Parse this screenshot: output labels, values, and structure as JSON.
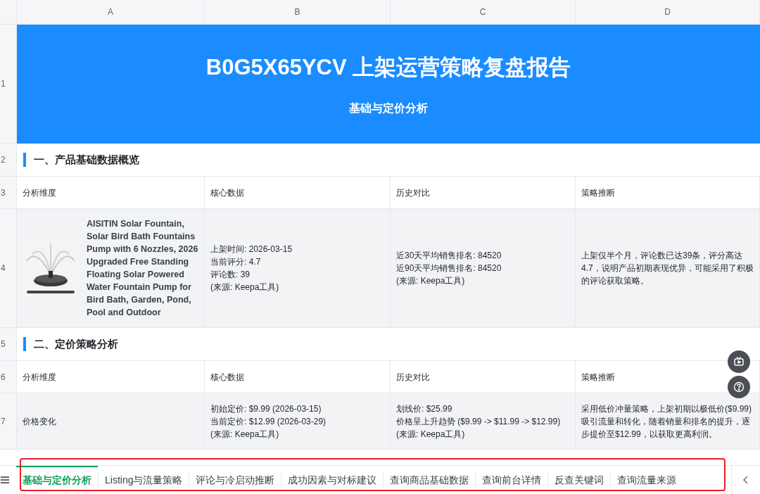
{
  "column_headers": [
    "A",
    "B",
    "C",
    "D"
  ],
  "rows": [
    {
      "number": "1",
      "kind": "banner",
      "title": "B0G5X65YCV 上架运营策略复盘报告",
      "subtitle": "基础与定价分析"
    },
    {
      "number": "2",
      "kind": "section",
      "title": "一、产品基础数据概览"
    },
    {
      "number": "3",
      "kind": "header",
      "cells": [
        [
          "分析维度"
        ],
        [
          "核心数据"
        ],
        [
          "历史对比"
        ],
        [
          "策略推断"
        ]
      ]
    },
    {
      "number": "4",
      "kind": "product",
      "product": {
        "title": "AISITIN Solar Fountain, Solar Bird Bath Fountains Pump with 6 Nozzles, 2026 Upgraded Free Standing Floating Solar Powered Water Fountain Pump for Bird Bath, Garden, Pond, Pool and Outdoor"
      },
      "cells": [
        [
          "上架时间: 2026-03-15",
          "当前评分: 4.7",
          "评论数: 39",
          "(来源: Keepa工具)"
        ],
        [
          "近30天平均销售排名: 84520",
          "近90天平均销售排名: 84520",
          "(来源: Keepa工具)"
        ],
        [
          "上架仅半个月，评论数已达39条，评分高达4.7，说明产品初期表现优异，可能采用了积极的评论获取策略。"
        ]
      ]
    },
    {
      "number": "5",
      "kind": "section",
      "title": "二、定价策略分析"
    },
    {
      "number": "6",
      "kind": "header",
      "cells": [
        [
          "分析维度"
        ],
        [
          "核心数据"
        ],
        [
          "历史对比"
        ],
        [
          "策略推断"
        ]
      ]
    },
    {
      "number": "7",
      "kind": "data",
      "cells": [
        [
          "价格变化"
        ],
        [
          "初始定价: $9.99 (2026-03-15)",
          "当前定价: $12.99 (2026-03-29)",
          "(来源: Keepa工具)"
        ],
        [
          "划线价: $25.99",
          "价格呈上升趋势 ($9.99 -> $11.99 -> $12.99)",
          "(来源: Keepa工具)"
        ],
        [
          "采用低价冲量策略，上架初期以极低价($9.99)吸引流量和转化，随着销量和排名的提升，逐步提价至$12.99，以获取更高利润。"
        ]
      ]
    }
  ],
  "sheet_tabs": [
    {
      "label": "基础与定价分析",
      "selected": true
    },
    {
      "label": "Listing与流量策略",
      "selected": false
    },
    {
      "label": "评论与冷启动推断",
      "selected": false
    },
    {
      "label": "成功因素与对标建议",
      "selected": false
    },
    {
      "label": "查询商品基础数据",
      "selected": false
    },
    {
      "label": "查询前台详情",
      "selected": false
    },
    {
      "label": "反查关键词",
      "selected": false
    },
    {
      "label": "查询流量来源",
      "selected": false
    }
  ]
}
